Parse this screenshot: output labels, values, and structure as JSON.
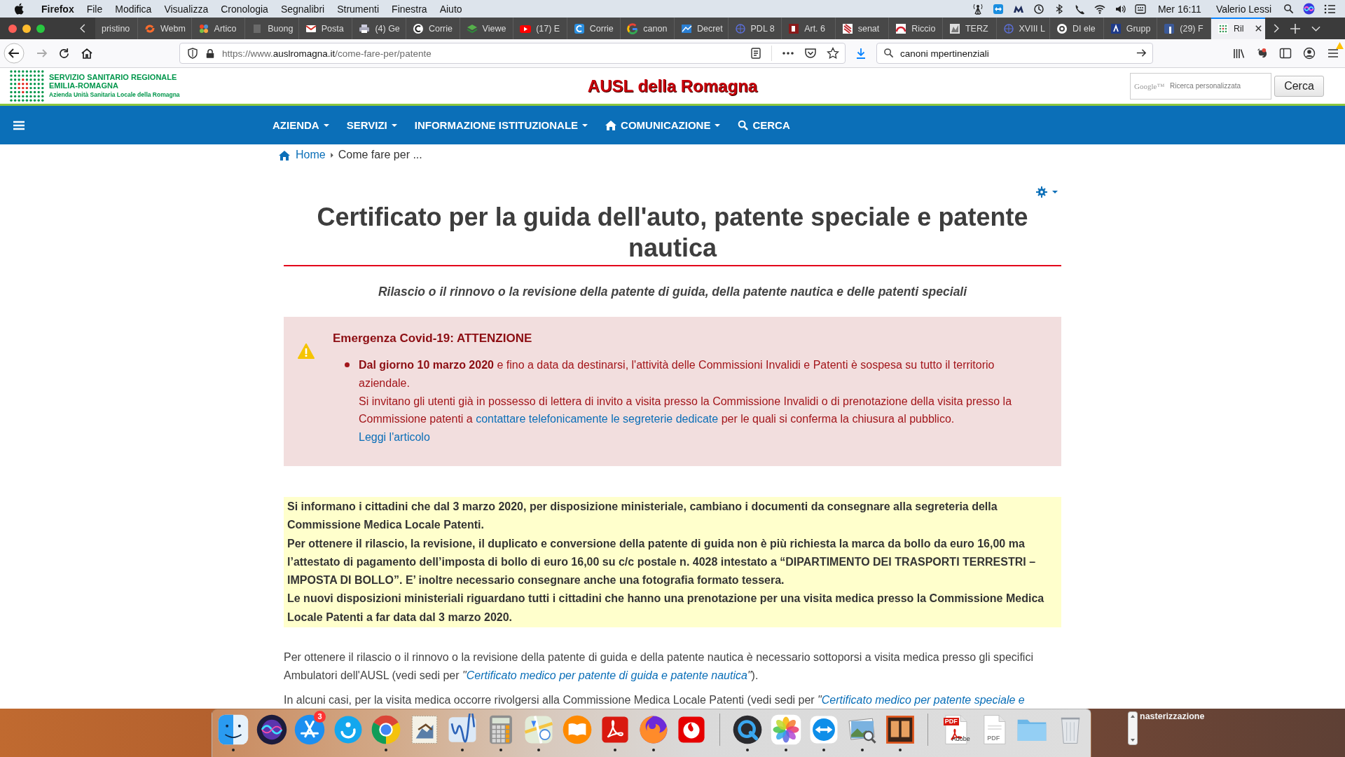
{
  "menubar": {
    "app": "Firefox",
    "menus": [
      "File",
      "Modifica",
      "Visualizza",
      "Cronologia",
      "Segnalibri",
      "Strumenti",
      "Finestra",
      "Aiuto"
    ],
    "clock": "Mer 16:11",
    "user": "Valerio Lessi"
  },
  "tabs": [
    {
      "label": "pristino",
      "kind": "none",
      "selected": false
    },
    {
      "label": "Webm",
      "kind": "swirl",
      "selected": false
    },
    {
      "label": "Artico",
      "kind": "pinwheel",
      "selected": false
    },
    {
      "label": "Buong",
      "kind": "page",
      "selected": false
    },
    {
      "label": "Posta",
      "kind": "envelope",
      "selected": false
    },
    {
      "label": "(4) Ge",
      "kind": "printer",
      "selected": false
    },
    {
      "label": "Corrie",
      "kind": "ring",
      "selected": false
    },
    {
      "label": "Viewe",
      "kind": "layers",
      "selected": false
    },
    {
      "label": "(17) E",
      "kind": "play",
      "selected": false
    },
    {
      "label": "Corrie",
      "kind": "tile",
      "selected": false
    },
    {
      "label": "canon",
      "kind": "segments",
      "selected": false
    },
    {
      "label": "Decret",
      "kind": "chart",
      "selected": false
    },
    {
      "label": "PDL 8",
      "kind": "seal",
      "selected": false
    },
    {
      "label": "Art. 6",
      "kind": "square",
      "selected": false
    },
    {
      "label": "senat",
      "kind": "emblem",
      "selected": false
    },
    {
      "label": "Riccio",
      "kind": "arch",
      "selected": false
    },
    {
      "label": "TERZ",
      "kind": "image",
      "selected": false
    },
    {
      "label": "XVIII L",
      "kind": "seal",
      "selected": false
    },
    {
      "label": "DI ele",
      "kind": "circle",
      "selected": false
    },
    {
      "label": "Grupp",
      "kind": "peak",
      "selected": false
    },
    {
      "label": "(29) F",
      "kind": "social",
      "selected": false
    },
    {
      "label": "Ril",
      "kind": "grid",
      "selected": true
    }
  ],
  "toolbar": {
    "url": {
      "scheme": "https://www.",
      "domain": "auslromagna.it",
      "path": "/come-fare-per/patente"
    },
    "search": {
      "value": "canoni mpertinenziali"
    }
  },
  "header": {
    "logo": {
      "line_1": "SERVIZIO SANITARIO REGIONALE",
      "line_2": "EMILIA-ROMAGNA",
      "line_3": "Azienda Unità Sanitaria Locale della Romagna"
    },
    "title": "AUSL della Romagna",
    "search": {
      "brand": "Google™",
      "placeholder": "Ricerca personalizzata",
      "button": "Cerca"
    }
  },
  "nav": {
    "items": [
      {
        "label": "AZIENDA",
        "kind": "dropdown"
      },
      {
        "label": "SERVIZI",
        "kind": "dropdown"
      },
      {
        "label": "INFORMAZIONE ISTITUZIONALE",
        "kind": "dropdown"
      },
      {
        "label": "COMUNICAZIONE",
        "kind": "home_dropdown"
      },
      {
        "label": "CERCA",
        "kind": "search"
      }
    ]
  },
  "breadcrumb": [
    {
      "label": "Home",
      "kind": "home_link"
    },
    {
      "label": "Come fare per ...",
      "kind": "current"
    }
  ],
  "article": {
    "title": "Certificato per la guida dell'auto, patente speciale e patente nautica",
    "subtitle": "Rilascio o il rinnovo o la revisione della patente di guida, della patente nautica e delle patenti speciali",
    "alert": {
      "title": "Emergenza Covid-19: ATTENZIONE",
      "bullets": [
        {
          "lines": [
            {
              "parts": [
                {
                  "kind": "text",
                  "text": "**Dal giorno 10 marzo 2020** e fino a data da destinarsi, l'attività delle Commissioni Invalidi e Patenti è sospesa su tutto il territorio aziendale."
                }
              ]
            },
            {
              "parts": [
                {
                  "kind": "text",
                  "text": "Si invitano gli utenti già in possesso di lettera di invito a visita presso la Commissione Invalidi o di prenotazione della visita presso la Commissione patenti a "
                },
                {
                  "kind": "link",
                  "text": "contattare telefonicamente le segreterie dedicate"
                },
                {
                  "kind": "text",
                  "text": " per le quali si conferma la chiusura al pubblico."
                }
              ]
            },
            {
              "parts": [
                {
                  "kind": "link",
                  "text": "Leggi l'articolo"
                }
              ]
            }
          ]
        }
      ]
    },
    "notice": {
      "paragraphs": [
        "Si informano i cittadini che dal 3 marzo 2020, per disposizione ministeriale, cambiano i documenti da consegnare alla segreteria della Commissione Medica Locale Patenti.",
        "Per ottenere il rilascio, la revisione, il duplicato e conversione della patente di guida non è più richiesta la marca da bollo da euro 16,00 ma l’attestato di pagamento dell’imposta di bollo di euro 16,00 su c/c postale n. 4028 intestato a “DIPARTIMENTO DEI TRASPORTI TERRESTRI – IMPOSTA DI BOLLO”. E’ inoltre necessario consegnare anche una fotografia formato tessera.",
        "Le nuovi disposizioni ministeriali riguardano tutti i cittadini che hanno una prenotazione per una visita medica presso la Commissione Medica Locale Patenti a far data dal 3 marzo 2020."
      ]
    },
    "body": [
      {
        "parts": [
          {
            "kind": "text",
            "text": "Per ottenere il rilascio o il rinnovo o la revisione della patente di guida e della patente nautica è necessario sottoporsi a visita medica presso gli specifici Ambulatori dell'AUSL (vedi sedi per  *\"*"
          },
          {
            "kind": "link",
            "text": "Certificato medico per patente di guida e patente nautica"
          },
          {
            "kind": "text",
            "text": "*\"*)."
          }
        ]
      },
      {
        "parts": [
          {
            "kind": "text",
            "text": "In alcuni casi, per la visita medica occorre rivolgersi alla Commissione Medica Locale Patenti (vedi sedi per *\"*"
          },
          {
            "kind": "link",
            "text": "Certificato medico per patente speciale e"
          }
        ]
      }
    ]
  },
  "dock": {
    "groups": [
      [
        {
          "kind": "finder",
          "running": true
        },
        {
          "kind": "siri",
          "running": false
        },
        {
          "kind": "appstore",
          "running": false,
          "badge": "3"
        },
        {
          "kind": "skype",
          "running": false
        },
        {
          "kind": "chrome",
          "running": true
        },
        {
          "kind": "mail",
          "running": false
        },
        {
          "kind": "writer",
          "running": true
        },
        {
          "kind": "calculator",
          "running": true
        },
        {
          "kind": "maps",
          "running": true
        },
        {
          "kind": "books",
          "running": false
        },
        {
          "kind": "acrobat",
          "running": true
        },
        {
          "kind": "firefox",
          "running": true
        },
        {
          "kind": "vodafone",
          "running": false
        }
      ],
      [
        {
          "kind": "quicktime",
          "running": true
        },
        {
          "kind": "photos",
          "running": true
        },
        {
          "kind": "teamviewer",
          "running": true
        },
        {
          "kind": "preview",
          "running": true
        },
        {
          "kind": "reader",
          "running": true
        }
      ],
      [
        {
          "kind": "pdf_adobe",
          "tag": "PDF",
          "caption": "Adobe"
        },
        {
          "kind": "pdf",
          "tag": "PDF"
        },
        {
          "kind": "folder"
        },
        {
          "kind": "trash"
        }
      ]
    ],
    "desktop_label": "nasterizzazione"
  }
}
